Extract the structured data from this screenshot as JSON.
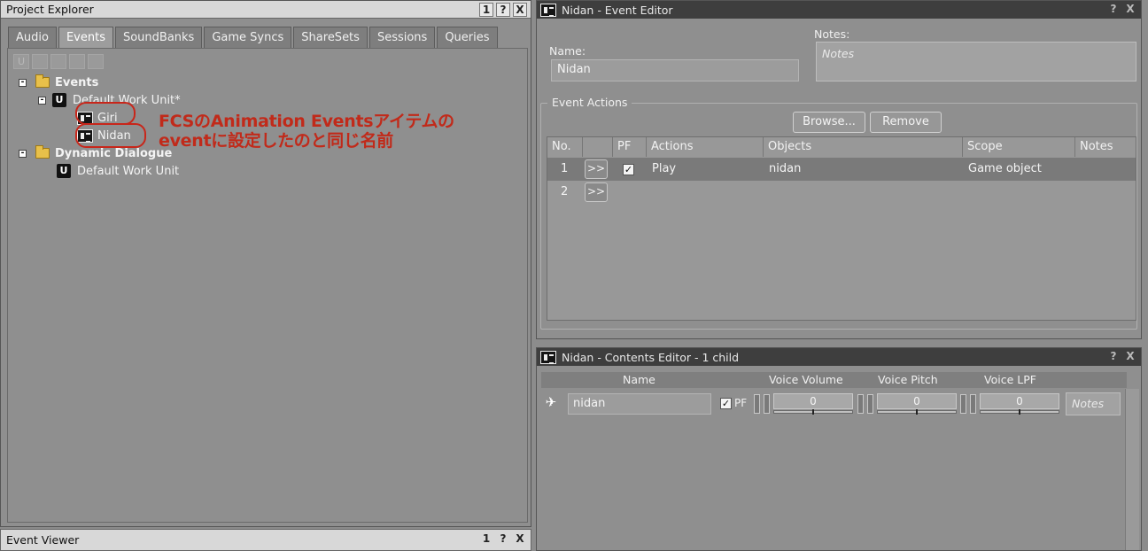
{
  "project_explorer": {
    "title": "Project Explorer",
    "title_buttons": [
      "1",
      "?",
      "X"
    ],
    "tabs": [
      "Audio",
      "Events",
      "SoundBanks",
      "Game Syncs",
      "ShareSets",
      "Sessions",
      "Queries"
    ],
    "active_tab": "Events",
    "toolbar_icons": [
      "work-unit-icon",
      "folder-icon",
      "folder-icon",
      "event-icon",
      "dialogue-event-icon"
    ],
    "tree": {
      "events_label": "Events",
      "events_work_unit": "Default Work Unit*",
      "event_giri": "Giri",
      "event_nidan": "Nidan",
      "dynamic_label": "Dynamic Dialogue",
      "dynamic_work_unit": "Default Work Unit"
    },
    "annotation_line1": "FCSのAnimation Eventsアイテムの",
    "annotation_line2": "eventに設定したのと同じ名前"
  },
  "event_viewer": {
    "title": "Event Viewer",
    "title_buttons": [
      "1",
      "?",
      "X"
    ]
  },
  "event_editor": {
    "title": "Nidan - Event Editor",
    "title_buttons": [
      "?",
      "X"
    ],
    "name_label": "Name:",
    "name_value": "Nidan",
    "notes_label": "Notes:",
    "notes_placeholder": "Notes",
    "group_label": "Event Actions",
    "browse_button": "Browse...",
    "remove_button": "Remove",
    "columns": {
      "no": "No.",
      "pf": "PF",
      "actions": "Actions",
      "objects": "Objects",
      "scope": "Scope",
      "notes": "Notes"
    },
    "rows": [
      {
        "no": "1",
        "arrow": ">>",
        "pf_checked": true,
        "action": "Play",
        "object": "nidan",
        "scope": "Game object"
      },
      {
        "no": "2",
        "arrow": ">>",
        "pf_checked": false,
        "action": "",
        "object": "",
        "scope": ""
      }
    ]
  },
  "contents_editor": {
    "title": "Nidan - Contents Editor - 1 child",
    "title_buttons": [
      "?",
      "X"
    ],
    "columns": {
      "name": "Name",
      "voice_volume": "Voice Volume",
      "voice_pitch": "Voice Pitch",
      "voice_lpf": "Voice LPF"
    },
    "row": {
      "name": "nidan",
      "pf_label": "PF",
      "pf_checked": true,
      "voice_volume": "0",
      "voice_pitch": "0",
      "voice_lpf": "0",
      "notes_placeholder": "Notes"
    }
  },
  "colors": {
    "annotation": "#c12a1a",
    "panel_bg": "#8f8f8f",
    "dark_title": "#3e3e3e",
    "folder": "#e8c04a"
  }
}
